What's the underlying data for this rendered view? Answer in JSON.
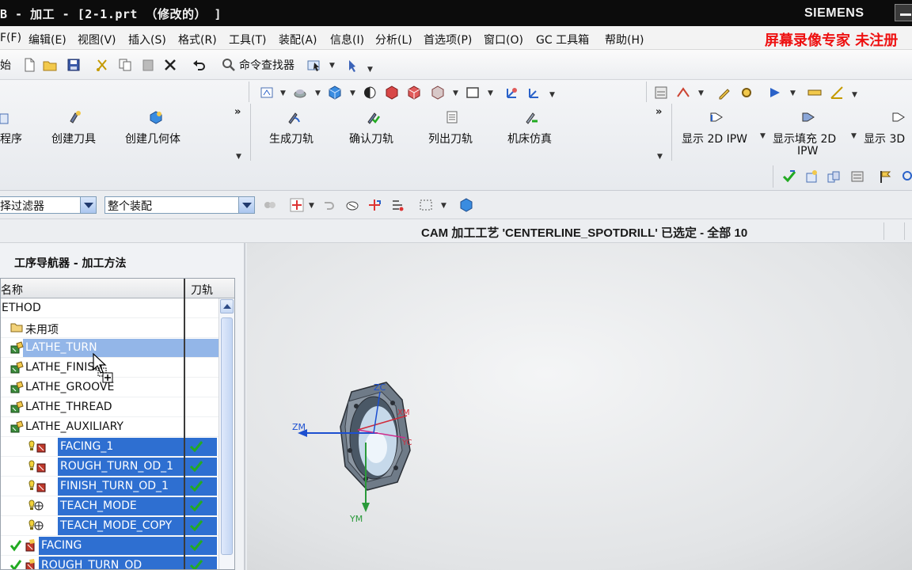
{
  "window": {
    "title": "B - 加工 - [2-1.prt （修改的） ]",
    "brand": "SIEMENS"
  },
  "menu": {
    "items": [
      "F(F)",
      "编辑(E)",
      "视图(V)",
      "插入(S)",
      "格式(R)",
      "工具(T)",
      "装配(A)",
      "信息(I)",
      "分析(L)",
      "首选项(P)",
      "窗口(O)",
      "GC 工具箱",
      "帮助(H)"
    ],
    "watermark": "屏幕录像专家 未注册"
  },
  "standard_toolbar": {
    "start_label": "始",
    "command_finder_label": "命令查找器"
  },
  "ribbon": {
    "group1": [
      {
        "label": "程序"
      },
      {
        "label": "创建刀具"
      },
      {
        "label": "创建几何体"
      }
    ],
    "group2": [
      {
        "label": "生成刀轨"
      },
      {
        "label": "确认刀轨"
      },
      {
        "label": "列出刀轨"
      },
      {
        "label": "机床仿真"
      }
    ],
    "group3": [
      {
        "label": "显示 2D IPW"
      },
      {
        "label": "显示填充 2D",
        "label2": "IPW"
      },
      {
        "label": "显示 3D"
      }
    ],
    "more_glyph": "»"
  },
  "filter_bar": {
    "type_filter": "择过滤器",
    "scope_filter": "整个装配"
  },
  "cue_line": {
    "status": "CAM 加工工艺 'CENTERLINE_SPOTDRILL' 已选定 - 全部 10"
  },
  "navigator": {
    "title": "工序导航器 - 加工方法",
    "columns": {
      "name": "名称",
      "toolpath": "刀轨"
    },
    "rows": [
      {
        "label": "ETHOD",
        "indent": 0,
        "selected": false,
        "check": false,
        "icon": "root"
      },
      {
        "label": "未用项",
        "indent": 1,
        "selected": false,
        "check": false,
        "icon": "folder"
      },
      {
        "label": "LATHE_TURN",
        "indent": 1,
        "selected": true,
        "light": true,
        "check": false,
        "icon": "method"
      },
      {
        "label": "LATHE_FINISH",
        "indent": 1,
        "selected": false,
        "check": false,
        "icon": "method"
      },
      {
        "label": "LATHE_GROOVE",
        "indent": 1,
        "selected": false,
        "check": false,
        "icon": "method"
      },
      {
        "label": "LATHE_THREAD",
        "indent": 1,
        "selected": false,
        "check": false,
        "icon": "method"
      },
      {
        "label": "LATHE_AUXILIARY",
        "indent": 1,
        "selected": false,
        "check": false,
        "icon": "method"
      },
      {
        "label": "FACING_1",
        "indent": 2,
        "selected": true,
        "check": true,
        "icon": "op"
      },
      {
        "label": "ROUGH_TURN_OD_1",
        "indent": 2,
        "selected": true,
        "check": true,
        "icon": "op"
      },
      {
        "label": "FINISH_TURN_OD_1",
        "indent": 2,
        "selected": true,
        "check": true,
        "icon": "op"
      },
      {
        "label": "TEACH_MODE",
        "indent": 2,
        "selected": true,
        "check": true,
        "icon": "teach"
      },
      {
        "label": "TEACH_MODE_COPY",
        "indent": 2,
        "selected": true,
        "check": true,
        "icon": "teach"
      },
      {
        "label": "FACING",
        "indent": 1,
        "selected": true,
        "check": true,
        "icon": "op-ok"
      },
      {
        "label": "ROUGH_TURN_OD",
        "indent": 1,
        "selected": true,
        "check": true,
        "icon": "op-ok"
      }
    ]
  },
  "viewport": {
    "axes": {
      "zm": "ZM",
      "ym": "YM",
      "zc": "ZC",
      "xm": "XM",
      "yc": "YC"
    }
  },
  "colors": {
    "selection": "#2e6fd1",
    "selection_light": "#93b6e8",
    "check": "#22aa22",
    "watermark": "#ee1111"
  }
}
